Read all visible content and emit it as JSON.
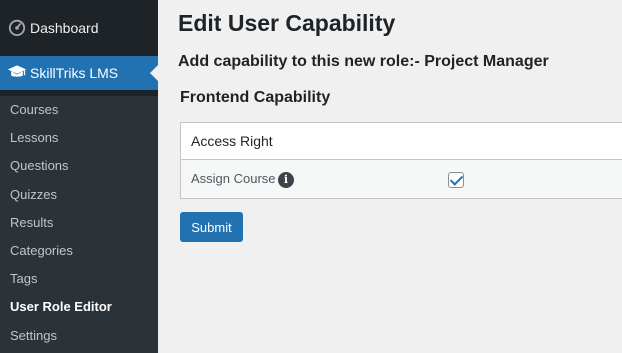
{
  "sidebar": {
    "dashboard_label": "Dashboard",
    "lms_label": "SkillTriks LMS",
    "items": [
      {
        "label": "Courses"
      },
      {
        "label": "Lessons"
      },
      {
        "label": "Questions"
      },
      {
        "label": "Quizzes"
      },
      {
        "label": "Results"
      },
      {
        "label": "Categories"
      },
      {
        "label": "Tags"
      },
      {
        "label": "User Role Editor"
      },
      {
        "label": "Settings"
      }
    ],
    "current_item": "User Role Editor"
  },
  "main": {
    "title": "Edit User Capability",
    "subtitle": "Add capability to this new role:- Project Manager",
    "section_title": "Frontend Capability",
    "table": {
      "header": "Access Right",
      "rows": [
        {
          "label": "Assign Course",
          "checked": true
        }
      ]
    },
    "submit_label": "Submit"
  },
  "colors": {
    "sidebar_bg": "#1d2327",
    "accent": "#2271b1",
    "page_bg": "#f0f0f1"
  }
}
